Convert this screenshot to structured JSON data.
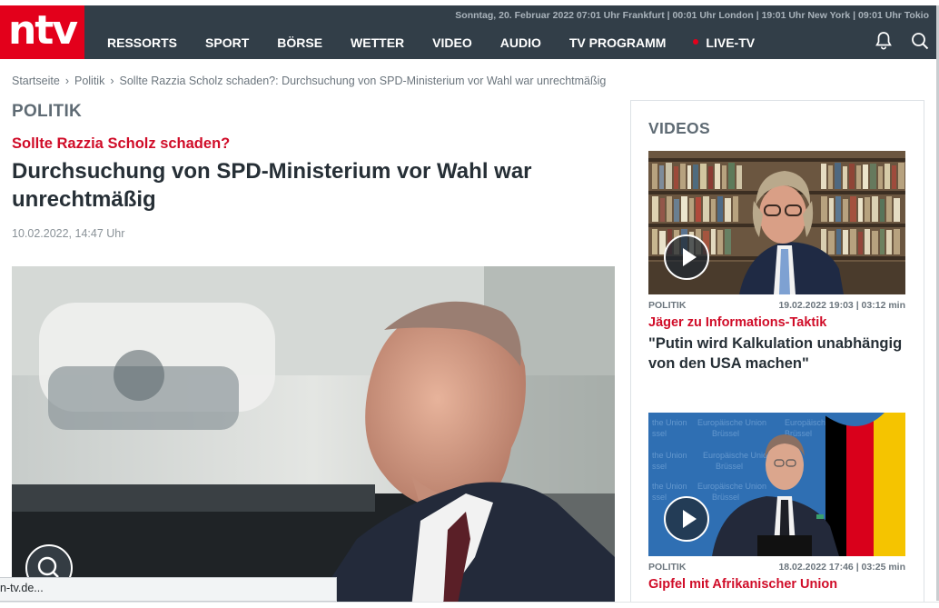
{
  "header": {
    "logo_text": "ntv",
    "ticker": "Sonntag, 20. Februar 2022 07:01 Uhr Frankfurt | 00:01 Uhr London | 19:01 Uhr New York | 09:01 Uhr Tokio",
    "nav": [
      {
        "label": "RESSORTS"
      },
      {
        "label": "SPORT"
      },
      {
        "label": "BÖRSE"
      },
      {
        "label": "WETTER"
      },
      {
        "label": "VIDEO"
      },
      {
        "label": "AUDIO"
      },
      {
        "label": "TV PROGRAMM"
      },
      {
        "label": "LIVE-TV"
      }
    ],
    "icons": [
      "bell-icon",
      "search-icon"
    ],
    "brand_color": "#e3001b",
    "bar_color": "#323e48"
  },
  "breadcrumb": {
    "items": [
      "Startseite",
      "Politik",
      "Sollte Razzia Scholz schaden?: Durchsuchung von SPD-Ministerium vor Wahl war unrechtmäßig"
    ]
  },
  "article": {
    "section": "POLITIK",
    "kicker": "Sollte Razzia Scholz schaden?",
    "headline": "Durchsuchung von SPD-Ministerium vor Wahl war unrechtmäßig",
    "date": "10.02.2022, 14:47 Uhr"
  },
  "sidebar": {
    "title": "VIDEOS",
    "videos": [
      {
        "category": "POLITIK",
        "meta": "19.02.2022 19:03 | 03:12 min",
        "kicker": "Jäger zu Informations-Taktik",
        "title": "\"Putin wird Kalkulation unabhängig von den USA machen\""
      },
      {
        "category": "POLITIK",
        "meta": "18.02.2022 17:46 | 03:25 min",
        "kicker": "Gipfel mit Afrikanischer Union",
        "title": ""
      }
    ]
  },
  "status_bar": {
    "text": "n-tv.de..."
  }
}
